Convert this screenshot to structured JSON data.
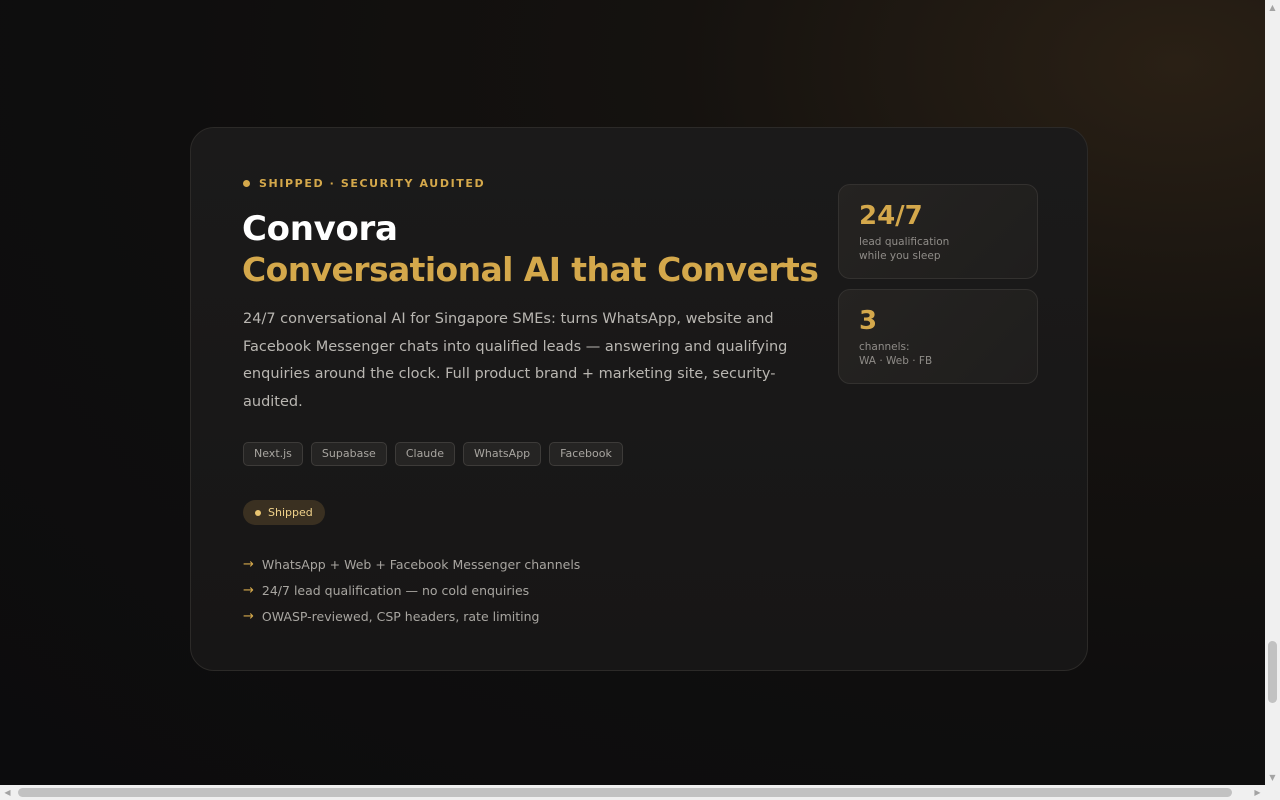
{
  "project": {
    "eyebrow": "SHIPPED · SECURITY AUDITED",
    "title": "Convora",
    "subtitle": "Conversational AI that Converts",
    "description": "24/7 conversational AI for Singapore SMEs: turns WhatsApp, website and Facebook Messenger chats into qualified leads — answering and qualifying enquiries around the clock. Full product brand + marketing site, security-audited.",
    "tags": [
      "Next.js",
      "Supabase",
      "Claude",
      "WhatsApp",
      "Facebook"
    ],
    "status": "Shipped",
    "features": [
      "WhatsApp + Web + Facebook Messenger channels",
      "24/7 lead qualification — no cold enquiries",
      "OWASP-reviewed, CSP headers, rate limiting"
    ],
    "feature_bullet": "→"
  },
  "stats": [
    {
      "value": "24/7",
      "caption_line1": "lead qualification",
      "caption_line2": "while you sleep"
    },
    {
      "value": "3",
      "caption_line1": "channels:",
      "caption_line2": "WA · Web · FB"
    }
  ],
  "scrollbars": {
    "vertical_position_percent": 96,
    "horizontal_position_percent": 0
  },
  "colors": {
    "accent": "#d4a84b",
    "card_background": "#1a1919",
    "page_background": "#0f0e0e",
    "status_pill_background": "#3a3021"
  },
  "icons": {
    "eyebrow_dot": "dot-icon",
    "status_dot": "dot-icon",
    "feature_bullet": "arrow-right-icon"
  }
}
